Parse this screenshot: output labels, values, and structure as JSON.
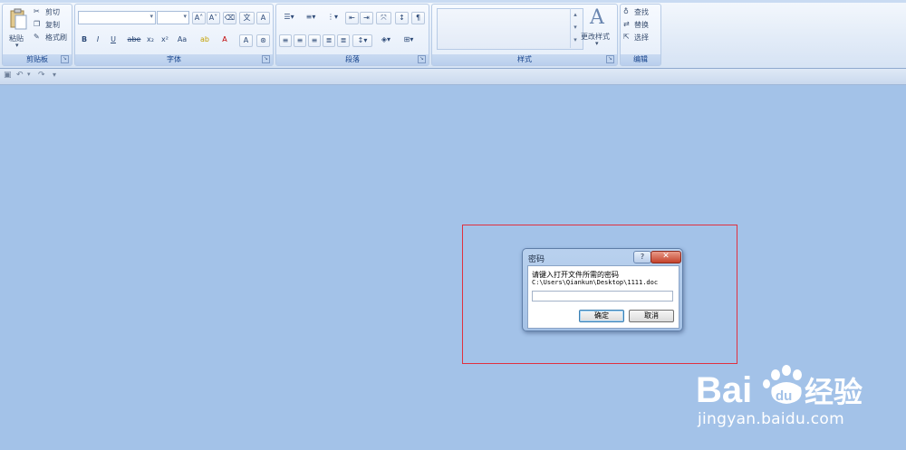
{
  "ribbon": {
    "clipboard": {
      "caption": "剪贴板",
      "paste": "粘贴",
      "cut": "剪切",
      "copy": "复制",
      "format_painter": "格式刷"
    },
    "font": {
      "caption": "字体",
      "buttons": [
        "B",
        "I",
        "U",
        "abe",
        "x₂",
        "x²",
        "Aa",
        "A",
        "A"
      ],
      "grow": "A˄",
      "shrink": "A˅"
    },
    "paragraph": {
      "caption": "段落"
    },
    "styles": {
      "caption": "样式",
      "change_styles": "更改样式",
      "styles_glyph": "A"
    },
    "editing": {
      "caption": "编辑",
      "find": "查找",
      "replace": "替换",
      "select": "选择"
    }
  },
  "dialog": {
    "title": "密码",
    "help_label": "?",
    "close_label": "✕",
    "prompt": "请键入打开文件所需的密码",
    "path": "C:\\Users\\Qiankun\\Desktop\\1111.doc",
    "password_value": "",
    "ok_label": "确定",
    "cancel_label": "取消"
  },
  "watermark": {
    "logo_text_a": "Bai",
    "logo_text_b": "du",
    "logo_text_c": "经验",
    "url": "jingyan.baidu.com"
  },
  "colors": {
    "workspace": "#a3c2e8",
    "highlight_border": "#e0313f",
    "ribbon_text": "#15428b"
  }
}
